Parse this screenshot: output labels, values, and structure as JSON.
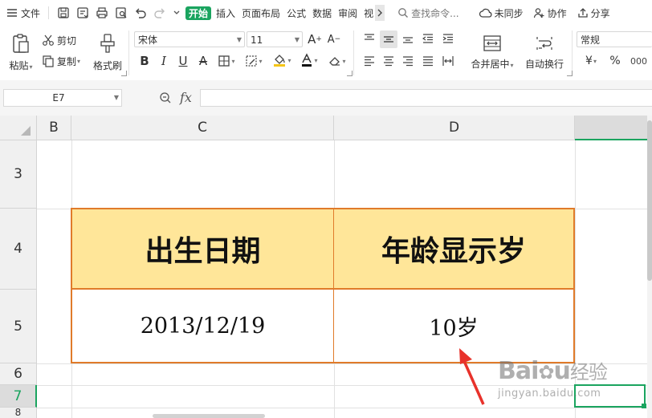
{
  "menubar": {
    "file_label": "文件",
    "tabs": [
      "开始",
      "插入",
      "页面布局",
      "公式",
      "数据",
      "审阅",
      "视"
    ],
    "search_placeholder": "查找命令...",
    "sync_label": "未同步",
    "collab_label": "协作",
    "share_label": "分享"
  },
  "ribbon": {
    "paste_label": "粘贴",
    "cut_label": "剪切",
    "copy_label": "复制",
    "format_painter_label": "格式刷",
    "font_name": "宋体",
    "font_size": "11",
    "merge_label": "合并居中",
    "wrap_label": "自动换行",
    "number_format": "常规",
    "currency_symbol": "¥",
    "percent_symbol": "%"
  },
  "formula_bar": {
    "cell_ref": "E7",
    "fx_label": "fx",
    "formula_value": ""
  },
  "columns": [
    "B",
    "C",
    "D"
  ],
  "rows": [
    "3",
    "4",
    "5",
    "6",
    "7",
    "8"
  ],
  "table": {
    "header_birth": "出生日期",
    "header_age": "年龄显示岁",
    "birth_value": "2013/12/19",
    "age_value": "10岁"
  },
  "colors": {
    "accent_green": "#1aa45f",
    "header_fill": "#ffe699",
    "table_border": "#e07b2a",
    "arrow": "#e8322b"
  },
  "watermark": "Baidu经验 jingyan.baidu.com"
}
